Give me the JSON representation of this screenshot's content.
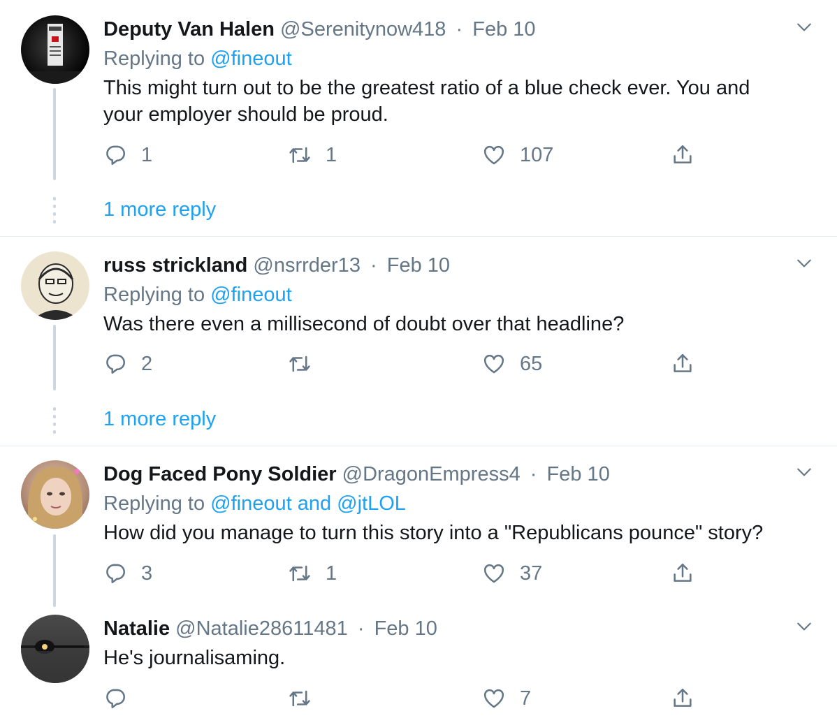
{
  "tweets": [
    {
      "name": "Deputy Van Halen",
      "handle": "@Serenitynow418",
      "sep": "·",
      "date": "Feb 10",
      "replying_prefix": "Replying to",
      "replying_to": "@fineout",
      "text_line1": "This might turn out to be the greatest ratio of a blue check ever.  You and",
      "text_line2": "your employer should be proud.",
      "reply_count": "1",
      "retweet_count": "1",
      "like_count": "107",
      "more_replies": "1 more reply"
    },
    {
      "name": "russ strickland",
      "handle": "@nsrrder13",
      "sep": "·",
      "date": "Feb 10",
      "replying_prefix": "Replying to",
      "replying_to": "@fineout",
      "text_line1": "Was there even a millisecond of doubt over that headline?",
      "reply_count": "2",
      "retweet_count": "",
      "like_count": "65",
      "more_replies": "1 more reply"
    },
    {
      "name": "Dog Faced Pony Soldier",
      "handle": "@DragonEmpress4",
      "sep": "·",
      "date": "Feb 10",
      "replying_prefix": "Replying to",
      "replying_to": "@fineout and @jtLOL",
      "text_line1": "How did you manage to turn this story into a \"Republicans pounce\" story?",
      "reply_count": "3",
      "retweet_count": "1",
      "like_count": "37"
    },
    {
      "name": "Natalie",
      "handle": "@Natalie28611481",
      "sep": "·",
      "date": "Feb 10",
      "text_line1": "He's journalisaming.",
      "reply_count": "",
      "retweet_count": "",
      "like_count": "7"
    }
  ],
  "icons": {
    "reply": "reply-icon",
    "retweet": "retweet-icon",
    "like": "heart-icon",
    "share": "share-icon",
    "more": "chevron-down-icon"
  },
  "colors": {
    "link": "#1da1f2",
    "muted": "#657786",
    "separator": "#e6ecf0",
    "thread_line": "#ccd6dd"
  }
}
